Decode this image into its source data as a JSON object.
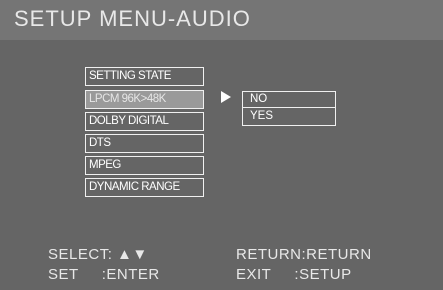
{
  "title": "SETUP MENU-AUDIO",
  "menu": {
    "items": [
      {
        "label": "SETTING STATE"
      },
      {
        "label": "LPCM 96K>48K"
      },
      {
        "label": "DOLBY DIGITAL"
      },
      {
        "label": "DTS"
      },
      {
        "label": "MPEG"
      },
      {
        "label": "DYNAMIC RANGE"
      }
    ],
    "selected": "LPCM 96K>48K"
  },
  "options": {
    "items": [
      {
        "label": "NO"
      },
      {
        "label": "YES"
      }
    ]
  },
  "footer": {
    "select": "SELECT: ▲▼",
    "return": "RETURN:RETURN",
    "set": "SET     :ENTER",
    "exit": "EXIT     :SETUP"
  },
  "colors": {
    "background": "#656565",
    "title_bar": "#757575",
    "highlight": "#9a9a9a",
    "text": "#ffffff"
  },
  "icons": {
    "submenu_arrow": "right-triangle-icon"
  }
}
